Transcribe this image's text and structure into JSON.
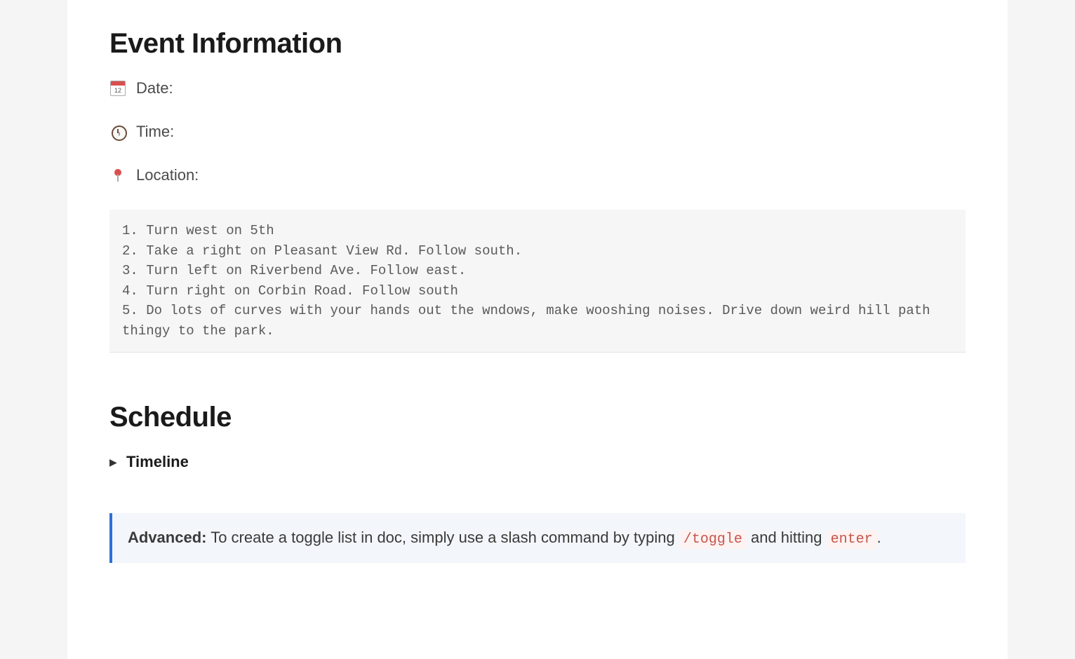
{
  "event_info": {
    "heading": "Event Information",
    "rows": [
      {
        "icon_name": "calendar-icon",
        "label": "Date:"
      },
      {
        "icon_name": "clock-icon",
        "label": "Time:"
      },
      {
        "icon_name": "pin-icon",
        "label": "Location:"
      }
    ],
    "directions": "1. Turn west on 5th\n2. Take a right on Pleasant View Rd. Follow south.\n3. Turn left on Riverbend Ave. Follow east.\n4. Turn right on Corbin Road. Follow south\n5. Do lots of curves with your hands out the wndows, make wooshing noises. Drive down weird hill path thingy to the park."
  },
  "schedule": {
    "heading": "Schedule",
    "toggle_label": "Timeline"
  },
  "callout": {
    "strong": "Advanced:",
    "text_1": " To create a toggle list in doc, simply use a slash command by typing ",
    "code_1": "/toggle",
    "text_2": " and hitting ",
    "code_2": "enter",
    "text_3": "."
  }
}
